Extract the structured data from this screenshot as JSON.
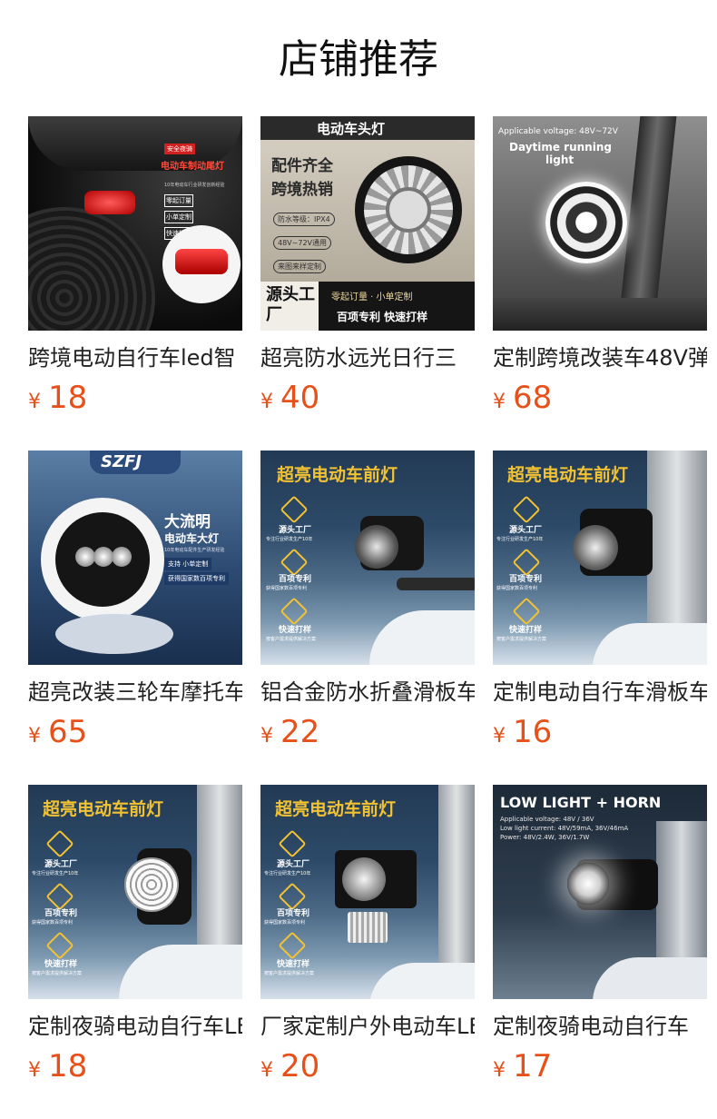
{
  "page": {
    "title": "店铺推荐"
  },
  "currency": "¥",
  "products": [
    {
      "name": "跨境电动自行车led智",
      "price": "18",
      "image_text": [
        "安全夜骑",
        "电动车制动尾灯",
        "10年电动车行业研发创新经验",
        "零起订量",
        "小单定制",
        "快速打样"
      ]
    },
    {
      "name": "超亮防水远光日行三",
      "price": "40",
      "image_text": [
        "电动车头灯",
        "配件齐全",
        "跨境热销",
        "防水等级：IPX4",
        "48V~72V通用",
        "来图来样定制",
        "源头工厂",
        "零起订量 · 小单定制",
        "百项专利  快速打样"
      ]
    },
    {
      "name": "定制跨境改装车48V弹",
      "price": "68",
      "image_text": [
        "Applicable voltage: 48V~72V",
        "Daytime running",
        "light"
      ]
    },
    {
      "name": "超亮改装三轮车摩托车",
      "price": "65",
      "image_text": [
        "SZFJ",
        "大流明",
        "电动车大灯",
        "10年电动车配件生产研发经验",
        "支持 小单定制",
        "获得国家数百项专利"
      ]
    },
    {
      "name": "铝合金防水折叠滑板车",
      "price": "22",
      "image_text": [
        "超亮电动车前灯",
        "源头工厂",
        "专注行业研发生产10年",
        "百项专利",
        "获得国家数百项专利",
        "快速打样",
        "按客户需求提供解决方案"
      ]
    },
    {
      "name": "定制电动自行车滑板车",
      "price": "16",
      "image_text": [
        "超亮电动车前灯",
        "源头工厂",
        "专注行业研发生产10年",
        "百项专利",
        "获得国家数百项专利",
        "快速打样",
        "按客户需求提供解决方案"
      ]
    },
    {
      "name": "定制夜骑电动自行车LED",
      "price": "18",
      "image_text": [
        "超亮电动车前灯",
        "源头工厂",
        "专注行业研发生产10年",
        "百项专利",
        "获得国家数百项专利",
        "快速打样",
        "按客户需求提供解决方案"
      ]
    },
    {
      "name": "厂家定制户外电动车LED",
      "price": "20",
      "image_text": [
        "超亮电动车前灯",
        "源头工厂",
        "专注行业研发生产10年",
        "百项专利",
        "获得国家数百项专利",
        "快速打样",
        "按客户需求提供解决方案"
      ]
    },
    {
      "name": "定制夜骑电动自行车",
      "price": "17",
      "image_text": [
        "LOW LIGHT + HORN",
        "Applicable voltage: 48V / 36V",
        "Low light current: 48V/59mA, 36V/46mA",
        "Power: 48V/2.4W, 36V/1.7W"
      ]
    }
  ],
  "colors": {
    "price": "#e8501a",
    "title": "#111111",
    "name": "#222222",
    "accent_gold": "#f2c233"
  }
}
